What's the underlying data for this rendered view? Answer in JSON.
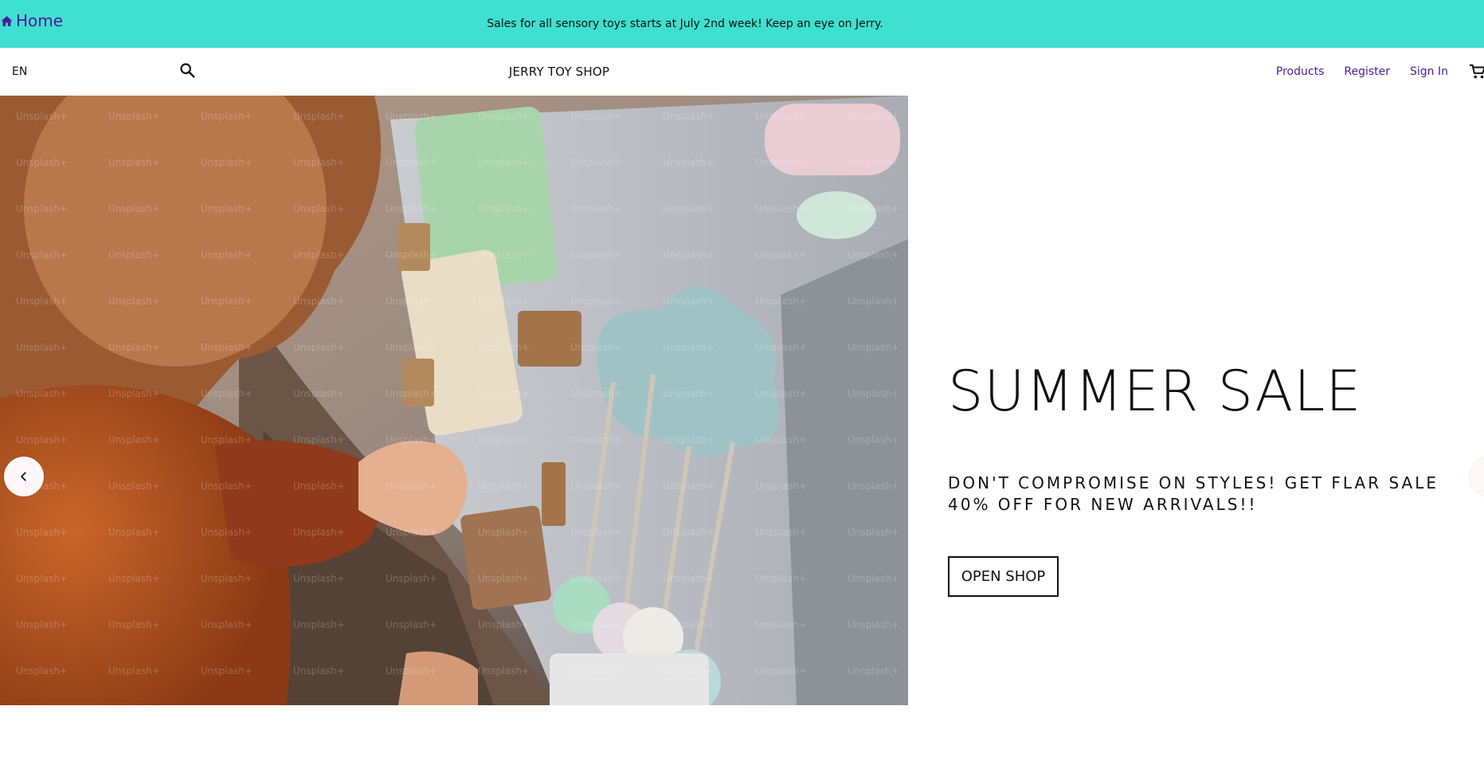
{
  "announcement": {
    "home_label": "Home",
    "text": "Sales for all sensory toys starts at July 2nd week! Keep an eye on Jerry."
  },
  "navbar": {
    "language": "EN",
    "brand": "JERRY TOY SHOP",
    "links": [
      "Products",
      "Register",
      "Sign In"
    ],
    "icons": [
      "search-icon",
      "cart-icon",
      "home-icon"
    ]
  },
  "hero": {
    "title": "SUMMER SALE",
    "description": "DON'T COMPROMISE ON STYLES! GET FLAR SALE 40% OFF FOR NEW ARRIVALS!!",
    "button_label": "OPEN SHOP",
    "image_description_icon": "photo",
    "watermark": "Unsplash+",
    "arrows": [
      "arrow-left-icon",
      "arrow-right-icon"
    ]
  },
  "colors": {
    "announcement_bg": "#3fe0d0",
    "link_purple": "#4a1c9c",
    "text": "#111111",
    "arrow_bg": "#fff7f7"
  }
}
